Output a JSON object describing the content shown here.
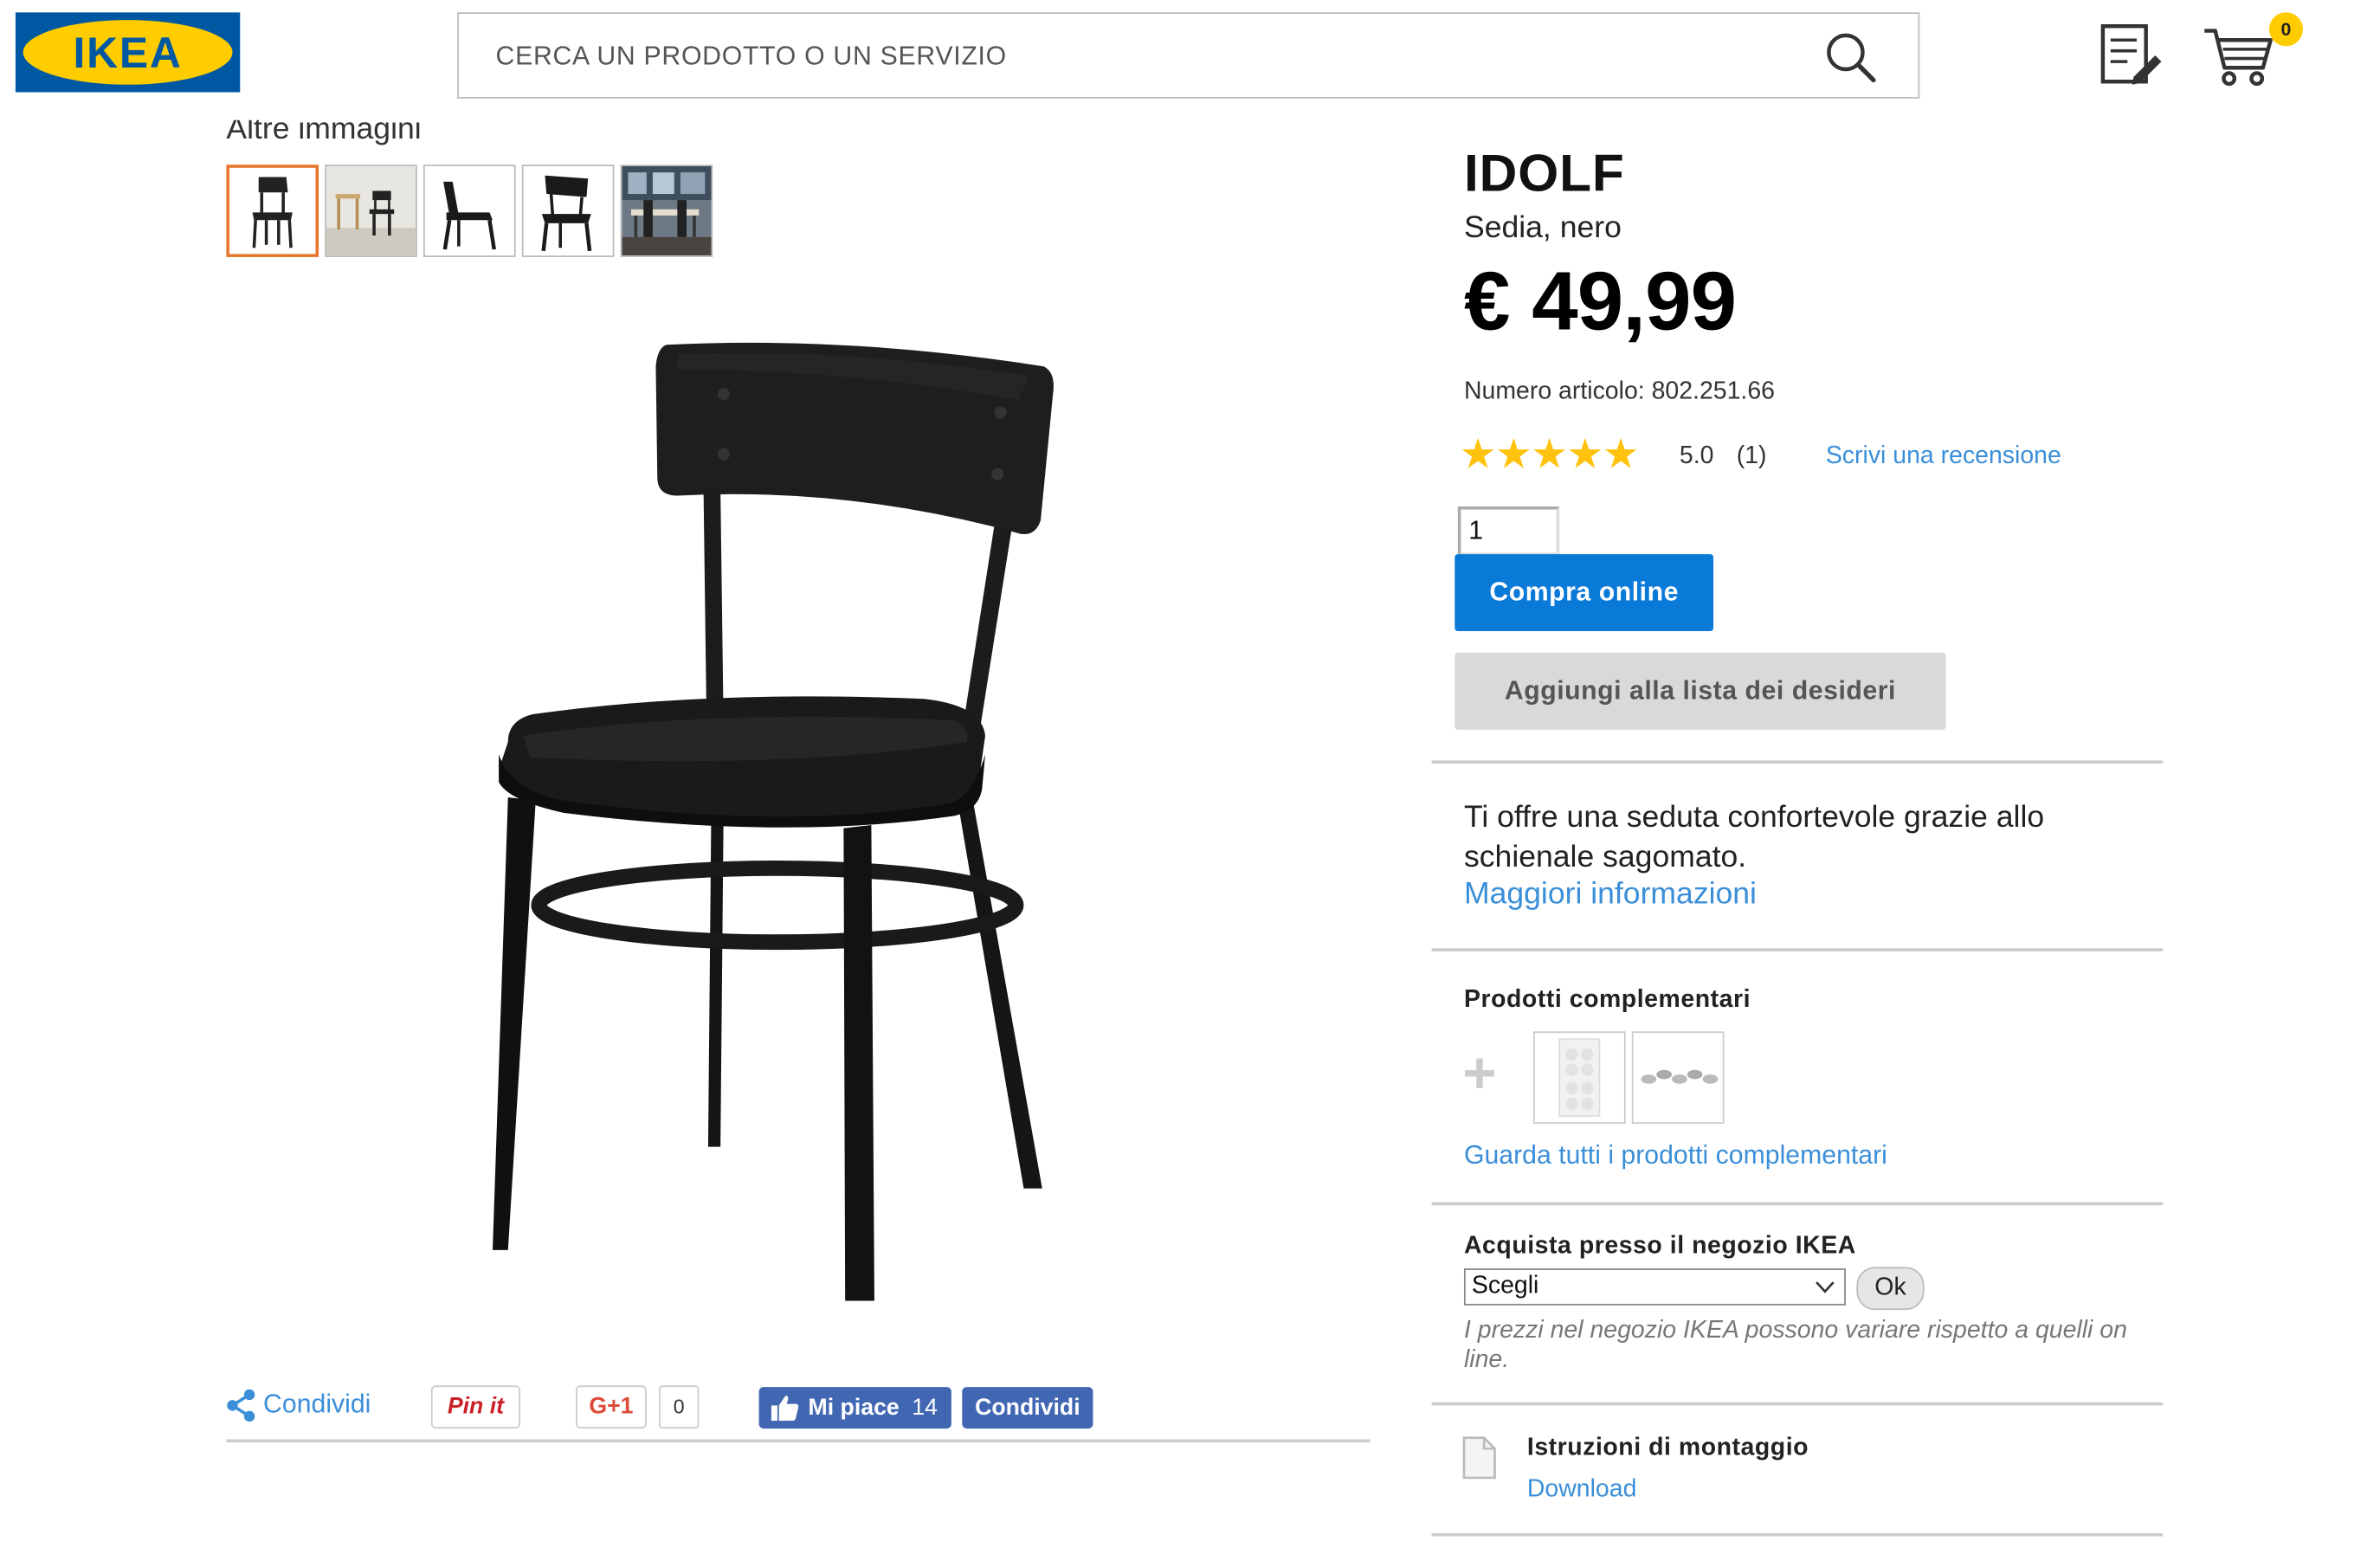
{
  "header": {
    "logo_text": "IKEA",
    "search_placeholder": "CERCA UN PRODOTTO O UN SERVIZIO",
    "cart_count": "0"
  },
  "gallery": {
    "label": "Altre immagini",
    "thumbnails": [
      "chair-front",
      "chair-with-table",
      "chair-side",
      "chair-three-quarter",
      "dining-room"
    ]
  },
  "product": {
    "name": "IDOLF",
    "type": "Sedia, nero",
    "price": "€ 49,99",
    "article": "Numero articolo: 802.251.66",
    "stars": "★★★★★",
    "rating": "5.0",
    "rating_count": "(1)",
    "write_review": "Scrivi una recensione",
    "quantity": "1",
    "buy_label": "Compra online",
    "wishlist_label": "Aggiungi alla lista dei desideri",
    "description": "Ti offre una seduta confortevole grazie allo schienale sagomato.",
    "more_info": "Maggiori informazioni"
  },
  "complementary": {
    "title": "Prodotti complementari",
    "see_all": "Guarda tutti i prodotti complementari"
  },
  "store": {
    "title": "Acquista presso il negozio IKEA",
    "select_value": "Scegli",
    "ok_label": "Ok",
    "note": "I prezzi nel negozio IKEA possono variare rispetto a quelli on line."
  },
  "assembly": {
    "title": "Istruzioni di montaggio",
    "download": "Download"
  },
  "share": {
    "share_label": "Condividi",
    "pin_label": "Pin it",
    "gplus_label": "G+1",
    "gplus_count": "0",
    "fb_like_label": "Mi piace",
    "fb_like_count": "14",
    "fb_share_label": "Condividi"
  },
  "colors": {
    "link": "#3b8fd8",
    "primary_button": "#0a7ad9",
    "ikea_blue": "#0058a3",
    "ikea_yellow": "#ffcc00",
    "selected_thumb_border": "#e8772d",
    "star": "#ffc20e"
  }
}
